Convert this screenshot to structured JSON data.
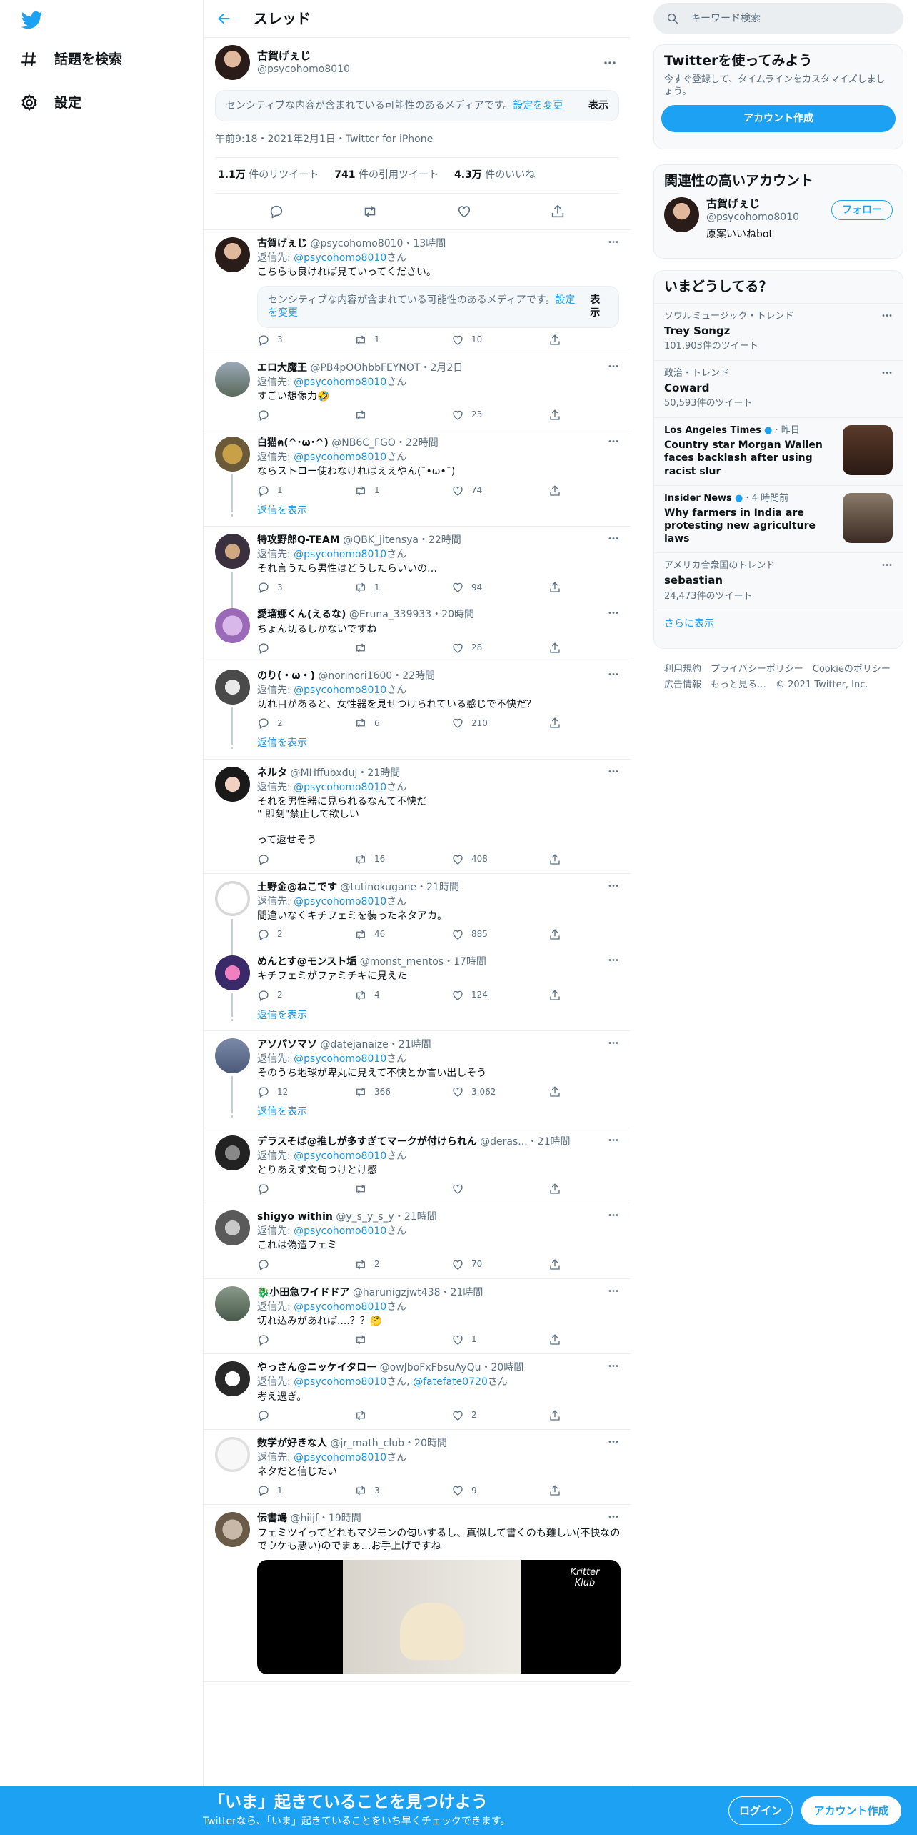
{
  "nav": {
    "explore": "話題を検索",
    "settings": "設定"
  },
  "header": {
    "title": "スレッド"
  },
  "focus": {
    "name": "古賀げぇじ",
    "handle": "@psycohomo8010",
    "sensitive_text": "センシティブな内容が含まれている可能性のあるメディアです。",
    "sensitive_link": "設定を変更",
    "show": "表示",
    "meta": "午前9:18・2021年2月1日・Twitter for iPhone",
    "retweets_num": "1.1万",
    "retweets_label": "件のリツイート",
    "quotes_num": "741",
    "quotes_label": "件の引用ツイート",
    "likes_num": "4.3万",
    "likes_label": "件のいいね"
  },
  "reply_prefix": "返信先: ",
  "reply_suffix": "さん",
  "show_replies": "返信を表示",
  "tweets": [
    {
      "name": "古賀げぇじ",
      "handle": "@psycohomo8010",
      "time": "13時間",
      "reply_to": "@psycohomo8010",
      "text": "こちらも良ければ見ていってください。",
      "sensitive": "センシティブな内容が含まれている可能性のあるメディアです。",
      "sensitive_link": "設定を変更",
      "show": "表示",
      "replies": "3",
      "retweets": "1",
      "likes": "10"
    },
    {
      "name": "エロ大魔王",
      "handle": "@PB4pOOhbbFEYNOT",
      "time": "2月2日",
      "reply_to": "@psycohomo8010",
      "text": "すごい想像力🤣",
      "replies": "",
      "retweets": "",
      "likes": "23"
    },
    {
      "name": "白猫ฅ(^･ω･^)",
      "handle": "@NB6C_FGO",
      "time": "22時間",
      "reply_to": "@psycohomo8010",
      "text": "ならストロー使わなければええやん(¯•ω•¯)",
      "replies": "1",
      "retweets": "1",
      "likes": "74"
    },
    {
      "name": "特攻野郎Q-TEAM",
      "handle": "@QBK_jitensya",
      "time": "22時間",
      "reply_to": "@psycohomo8010",
      "text": "それ言うたら男性はどうしたらいいの…",
      "replies": "3",
      "retweets": "1",
      "likes": "94"
    },
    {
      "name": "愛瑠娜くん(えるな)",
      "handle": "@Eruna_339933",
      "time": "20時間",
      "reply_to": "",
      "text": "ちょん切るしかないですね",
      "replies": "",
      "retweets": "",
      "likes": "28"
    },
    {
      "name": "のり(・ω・)",
      "handle": "@norinori1600",
      "time": "22時間",
      "reply_to": "@psycohomo8010",
      "text": "切れ目があると、女性器を見せつけられている感じで不快だ？",
      "replies": "2",
      "retweets": "6",
      "likes": "210"
    },
    {
      "name": "ネルタ",
      "handle": "@MHffubxduj",
      "time": "21時間",
      "reply_to": "@psycohomo8010",
      "text": "それを男性器に見られるなんて不快だ\n\" 即刻\"禁止して欲しい\n\nって返せそう",
      "replies": "",
      "retweets": "16",
      "likes": "408"
    },
    {
      "name": "土野金@ねこです",
      "handle": "@tutinokugane",
      "time": "21時間",
      "reply_to": "@psycohomo8010",
      "text": "間違いなくキチフェミを装ったネタアカ。",
      "replies": "2",
      "retweets": "46",
      "likes": "885"
    },
    {
      "name": "めんとす@モンスト垢",
      "handle": "@monst_mentos",
      "time": "17時間",
      "reply_to": "",
      "text": "キチフェミがファミチキに見えた",
      "replies": "2",
      "retweets": "4",
      "likes": "124"
    },
    {
      "name": "アソパソマソ",
      "handle": "@datejanaize",
      "time": "21時間",
      "reply_to": "@psycohomo8010",
      "text": "そのうち地球が卑丸に見えて不快とか言い出しそう",
      "replies": "12",
      "retweets": "366",
      "likes": "3,062"
    },
    {
      "name": "デラスそば@推しが多すぎてマークが付けられん",
      "handle": "@deras...",
      "time": "21時間",
      "reply_to": "@psycohomo8010",
      "text": "とりあえず文句つけとけ感",
      "replies": "",
      "retweets": "",
      "likes": ""
    },
    {
      "name": "shigyo within",
      "handle": "@y_s_y_s_y",
      "time": "21時間",
      "reply_to": "@psycohomo8010",
      "text": "これは偽造フェミ",
      "replies": "",
      "retweets": "2",
      "likes": "70"
    },
    {
      "name": "🐉小田急ワイドドア",
      "handle": "@harunigzjwt438",
      "time": "21時間",
      "reply_to": "@psycohomo8010",
      "text": "切れ込みがあれば....？？🤔",
      "replies": "",
      "retweets": "",
      "likes": "1"
    },
    {
      "name": "やっさん@ニッケイタロー",
      "handle": "@owJboFxFbsuAyQu",
      "time": "20時間",
      "reply_to": "@psycohomo8010",
      "reply_to2": "@fatefate0720",
      "text": "考え過ぎ。",
      "replies": "",
      "retweets": "",
      "likes": "2"
    },
    {
      "name": "数学が好きな人",
      "handle": "@jr_math_club",
      "time": "20時間",
      "reply_to": "@psycohomo8010",
      "text": "ネタだと信じたい",
      "replies": "1",
      "retweets": "3",
      "likes": "9"
    },
    {
      "name": "伝書鳩",
      "handle": "@hiijf",
      "time": "19時間",
      "reply_to": "",
      "text": "フェミツイってどれもマジモンの匂いするし、真似して書くのも難しい(不快なのでウケも悪い)のでまぁ…お手上げですね",
      "media_label": "Kritter Klub",
      "replies": "",
      "retweets": "",
      "likes": ""
    }
  ],
  "right": {
    "search_placeholder": "キーワード検索",
    "signup_card": {
      "title": "Twitterを使ってみよう",
      "sub": "今すぐ登録して、タイムラインをカスタマイズしましょう。",
      "button": "アカウント作成"
    },
    "related": {
      "title": "関連性の高いアカウント",
      "name": "古賀げぇじ",
      "handle": "@psycohomo8010",
      "bio": "原案いいねbot",
      "follow": "フォロー"
    },
    "trends": {
      "title": "いまどうしてる？",
      "items": [
        {
          "cat": "ソウルミュージック・トレンド",
          "name": "Trey Songz",
          "count": "101,903件のツイート"
        },
        {
          "cat": "政治・トレンド",
          "name": "Coward",
          "count": "50,593件のツイート"
        }
      ],
      "news": [
        {
          "source": "Los Angeles Times",
          "time": "昨日",
          "headline": "Country star Morgan Wallen faces backlash after using racist slur"
        },
        {
          "source": "Insider News",
          "time": "4 時間前",
          "headline": "Why farmers in India are protesting new agriculture laws"
        }
      ],
      "us_trend": {
        "cat": "アメリカ合衆国のトレンド",
        "name": "sebastian",
        "count": "24,473件のツイート"
      },
      "more": "さらに表示"
    },
    "footer": {
      "line1": "利用規約　プライバシーポリシー　Cookieのポリシー",
      "line2": "広告情報　もっと見る…　© 2021 Twitter, Inc."
    }
  },
  "bottom": {
    "title": "「いま」起きていることを見つけよう",
    "sub": "Twitterなら、「いま」起きていることをいち早くチェックできます。",
    "login": "ログイン",
    "signup": "アカウント作成"
  },
  "colors": {
    "accent": "#1da1f2",
    "text": "#0f1419",
    "muted": "#5b7083"
  }
}
